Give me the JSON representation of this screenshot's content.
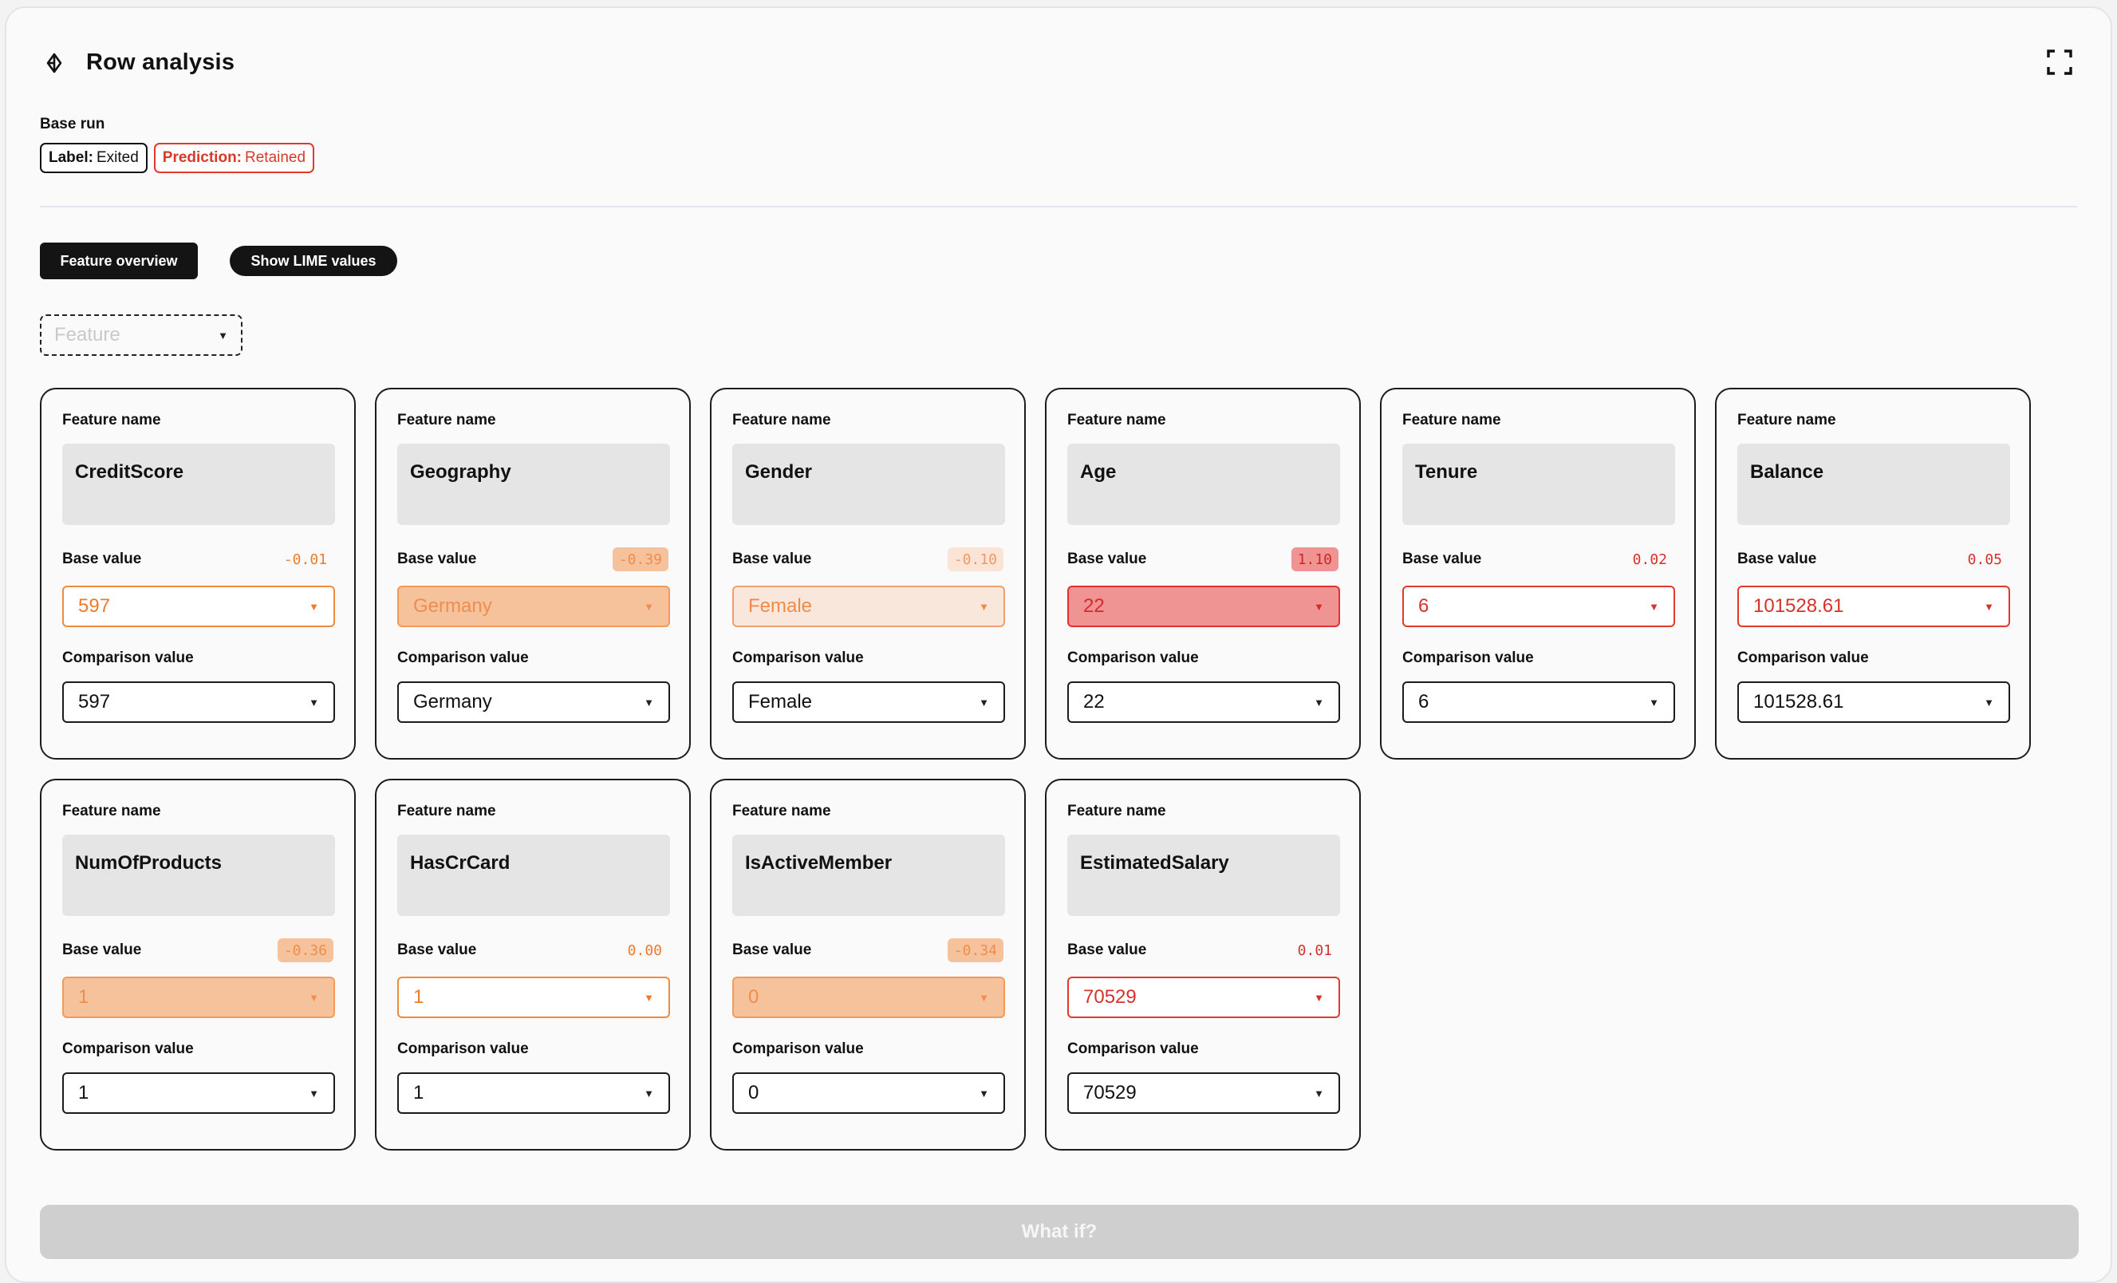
{
  "header": {
    "title": "Row analysis"
  },
  "base_run": {
    "label": "Base run",
    "label_badge": {
      "key": "Label:",
      "value": "Exited"
    },
    "prediction_badge": {
      "key": "Prediction:",
      "value": "Retained"
    }
  },
  "tabs": {
    "overview": "Feature overview",
    "lime": "Show LIME values"
  },
  "feature_select": {
    "placeholder": "Feature"
  },
  "card_labels": {
    "name": "Feature name",
    "base": "Base value",
    "comparison": "Comparison value"
  },
  "colors": {
    "accent_red": "#e23a2a",
    "accent_orange": "#f08a3c",
    "dark": "#141414"
  },
  "features": [
    {
      "name": "CreditScore",
      "score": "-0.01",
      "base_value": "597",
      "comparison_value": "597",
      "tone": "orange",
      "intensity": 0
    },
    {
      "name": "Geography",
      "score": "-0.39",
      "base_value": "Germany",
      "comparison_value": "Germany",
      "tone": "orange",
      "intensity": 2
    },
    {
      "name": "Gender",
      "score": "-0.10",
      "base_value": "Female",
      "comparison_value": "Female",
      "tone": "orange",
      "intensity": 1
    },
    {
      "name": "Age",
      "score": "1.10",
      "base_value": "22",
      "comparison_value": "22",
      "tone": "red",
      "intensity": 3
    },
    {
      "name": "Tenure",
      "score": "0.02",
      "base_value": "6",
      "comparison_value": "6",
      "tone": "red",
      "intensity": 0
    },
    {
      "name": "Balance",
      "score": "0.05",
      "base_value": "101528.61",
      "comparison_value": "101528.61",
      "tone": "red",
      "intensity": 0
    },
    {
      "name": "NumOfProducts",
      "score": "-0.36",
      "base_value": "1",
      "comparison_value": "1",
      "tone": "orange",
      "intensity": 2
    },
    {
      "name": "HasCrCard",
      "score": "0.00",
      "base_value": "1",
      "comparison_value": "1",
      "tone": "orange",
      "intensity": 0
    },
    {
      "name": "IsActiveMember",
      "score": "-0.34",
      "base_value": "0",
      "comparison_value": "0",
      "tone": "orange",
      "intensity": 2
    },
    {
      "name": "EstimatedSalary",
      "score": "0.01",
      "base_value": "70529",
      "comparison_value": "70529",
      "tone": "red",
      "intensity": 0
    }
  ],
  "what_if_button": "What if?"
}
